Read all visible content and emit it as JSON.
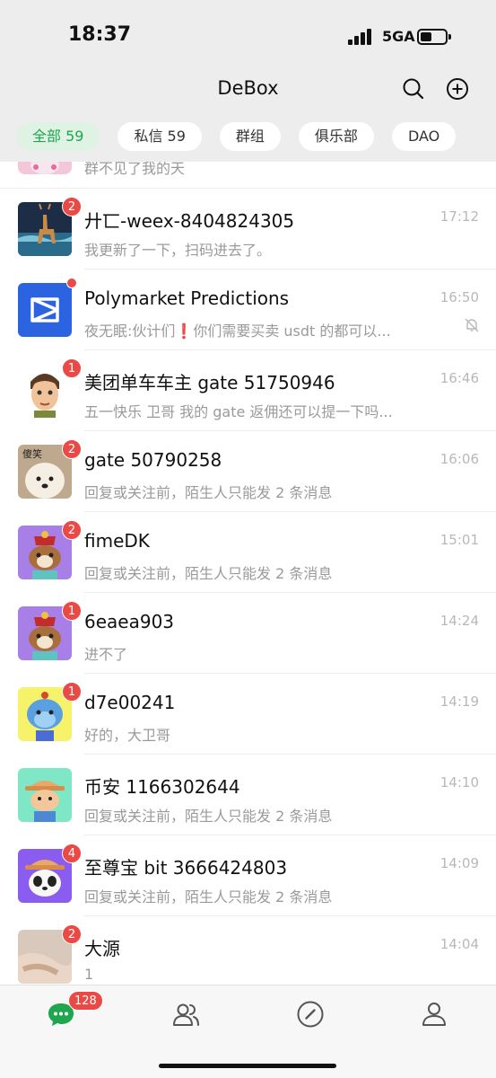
{
  "status_bar": {
    "time": "18:37",
    "network": "5GA"
  },
  "header": {
    "title": "DeBox"
  },
  "tabs": [
    {
      "label": "全部 59",
      "active": true
    },
    {
      "label": "私信 59",
      "active": false
    },
    {
      "label": "群组",
      "active": false
    },
    {
      "label": "俱乐部",
      "active": false
    },
    {
      "label": "DAO",
      "active": false
    }
  ],
  "partial_row": {
    "preview": "群不见了我的天"
  },
  "chats": [
    {
      "name": "廾匸-weex-8404824305",
      "preview": "我更新了一下，扫码进去了。",
      "time": "17:12",
      "badge": "2"
    },
    {
      "name": "Polymarket Predictions",
      "preview": "夜无眠:伙计们❗你们需要买卖 usdt 的都可以...",
      "time": "16:50",
      "badge": "",
      "muted": true
    },
    {
      "name": "美团单车车主 gate 51750946",
      "preview": "五一快乐 卫哥 我的 gate 返佣还可以提一下吗...",
      "time": "16:46",
      "badge": "1"
    },
    {
      "name": "gate 50790258",
      "preview": "回复或关注前，陌生人只能发 2 条消息",
      "time": "16:06",
      "badge": "2",
      "avatar_text": "傻笑"
    },
    {
      "name": "fimeDK",
      "preview": "回复或关注前，陌生人只能发 2 条消息",
      "time": "15:01",
      "badge": "2"
    },
    {
      "name": "6eaea903",
      "preview": "进不了",
      "time": "14:24",
      "badge": "1"
    },
    {
      "name": "d7e00241",
      "preview": "好的，大卫哥",
      "time": "14:19",
      "badge": "1"
    },
    {
      "name": "币安 1166302644",
      "preview": "回复或关注前，陌生人只能发 2 条消息",
      "time": "14:10",
      "badge": ""
    },
    {
      "name": "至尊宝 bit 3666424803",
      "preview": "回复或关注前，陌生人只能发 2 条消息",
      "time": "14:09",
      "badge": "4"
    },
    {
      "name": "大源",
      "preview": "1",
      "time": "14:04",
      "badge": "2"
    }
  ],
  "bottom_nav": {
    "chats_badge": "128"
  },
  "colors": {
    "accent_green": "#21a650",
    "badge_red": "#ea4a45",
    "header_bg": "#ededed"
  },
  "icons": [
    "signal-icon",
    "battery-icon",
    "search-icon",
    "add-circle-icon",
    "mute-bell-icon",
    "chat-bubble-icon",
    "contacts-icon",
    "compass-icon",
    "profile-icon"
  ]
}
